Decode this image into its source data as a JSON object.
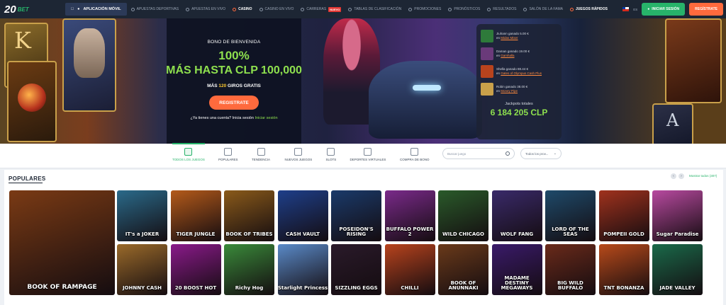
{
  "logo": {
    "num": "20",
    "word": "BET"
  },
  "app_button": "APLICACIÓN MÓVIL",
  "nav": [
    {
      "label": "APUESTAS DEPORTIVAS",
      "active": false,
      "badge": ""
    },
    {
      "label": "APUESTAS EN VIVO",
      "active": false,
      "badge": ""
    },
    {
      "label": "CASINO",
      "active": true,
      "badge": ""
    },
    {
      "label": "CASINO EN VIVO",
      "active": false,
      "badge": ""
    },
    {
      "label": "CARRERAS",
      "active": false,
      "badge": "NUEVO"
    },
    {
      "label": "TABLAS DE CLASIFICACIÓN",
      "active": false,
      "badge": ""
    },
    {
      "label": "PROMOCIONES",
      "active": false,
      "badge": ""
    },
    {
      "label": "PRONÓSTICOS",
      "active": false,
      "badge": ""
    },
    {
      "label": "RESULTADOS",
      "active": false,
      "badge": ""
    },
    {
      "label": "SALÓN DE LA FAMA",
      "active": false,
      "badge": ""
    },
    {
      "label": "JUEGOS RÁPIDOS",
      "active": true,
      "badge": ""
    }
  ],
  "lang": "ES",
  "login_button": "INICIAR SESIÓN",
  "register_button": "REGÍSTRATE",
  "promo": {
    "subtitle": "BONO DE BIENVENIDA",
    "percent": "100%",
    "line_prefix": "MÁS HASTA ",
    "line_amount": "CLP 100,000",
    "free_prefix": "MÁS ",
    "free_num": "120",
    "free_suffix": " GIROS GRATIS",
    "cta": "REGISTRATE",
    "login_q": "¿Ya tienes una cuenta? Inicia sesión ",
    "login_link": "Iniciar sesión"
  },
  "winners": [
    {
      "name": "Jiuhann ganado 5.00 €",
      "game": "Midas Miser",
      "color": "#2e7a3a"
    },
    {
      "name": "Daman ganado 19.00 €",
      "game": "Gamhalla",
      "color": "#6a3a7a"
    },
    {
      "name": "Shella ganado 88.44 €",
      "game": "Gates of Olympus Cash Plus",
      "color": "#b8431d"
    },
    {
      "name": "Robin ganado 38.00 €",
      "game": "Money Pipe",
      "color": "#c9a04a"
    }
  ],
  "jackpot": {
    "title": "Jackpots totales",
    "value": "6 184 205 CLP"
  },
  "categories": [
    {
      "label": "TODOS LOS JUEGOS",
      "active": true
    },
    {
      "label": "POPULARES",
      "active": false
    },
    {
      "label": "TENDENCIA",
      "active": false
    },
    {
      "label": "NUEVOS JUEGOS",
      "active": false
    },
    {
      "label": "SLOTS",
      "active": false
    },
    {
      "label": "DEPORTES VIRTUALES",
      "active": false
    },
    {
      "label": "COMPRA DE BONO",
      "active": false
    }
  ],
  "search": {
    "placeholder": "Buscar juego"
  },
  "provider_select": "Todos los prov...",
  "section": {
    "title": "POPULARES",
    "show_all": "Mostrar todos (307)"
  },
  "games_row1": [
    {
      "name": "IT's a JOKER",
      "color": "#2a6a8a"
    },
    {
      "name": "TIGER JUNGLE",
      "color": "#b45a1a"
    },
    {
      "name": "BOOK OF TRIBES",
      "color": "#8a5a1a"
    },
    {
      "name": "CASH VAULT",
      "color": "#1e3f8a"
    },
    {
      "name": "POSEIDON'S RISING",
      "color": "#1a3a6a"
    },
    {
      "name": "BUFFALO POWER 2",
      "color": "#7a2a8a"
    },
    {
      "name": "WILD CHICAGO",
      "color": "#2a5a2a"
    },
    {
      "name": "WOLF FANG",
      "color": "#3a2a6a"
    },
    {
      "name": "LORD OF THE SEAS",
      "color": "#1e4a6a"
    },
    {
      "name": "POMPEII GOLD",
      "color": "#a0321d"
    },
    {
      "name": "Sugar Paradise",
      "color": "#b84aa0"
    }
  ],
  "games_row2": [
    {
      "name": "JOHNNY CASH",
      "color": "#9a6a2a"
    },
    {
      "name": "20 BOOST HOT",
      "color": "#8a1a8a"
    },
    {
      "name": "Richy Hog",
      "color": "#3a8a3a"
    },
    {
      "name": "Starlight Princess",
      "color": "#5a8ac8"
    },
    {
      "name": "SIZZLING EGGS",
      "color": "#2a1a2a"
    },
    {
      "name": "CHILLI",
      "color": "#b8431d"
    },
    {
      "name": "BOOK OF ANUNNAKI",
      "color": "#6a3a1a"
    },
    {
      "name": "MADAME DESTINY MEGAWAYS",
      "color": "#3a1a6a"
    },
    {
      "name": "BIG WILD BUFFALO",
      "color": "#6a2a1a"
    },
    {
      "name": "TNT BONANZA",
      "color": "#b84a1a"
    },
    {
      "name": "JADE VALLEY",
      "color": "#1a6a4a"
    }
  ],
  "featured_game": {
    "name": "BOOK OF RAMPAGE",
    "color": "#7a3a14"
  }
}
